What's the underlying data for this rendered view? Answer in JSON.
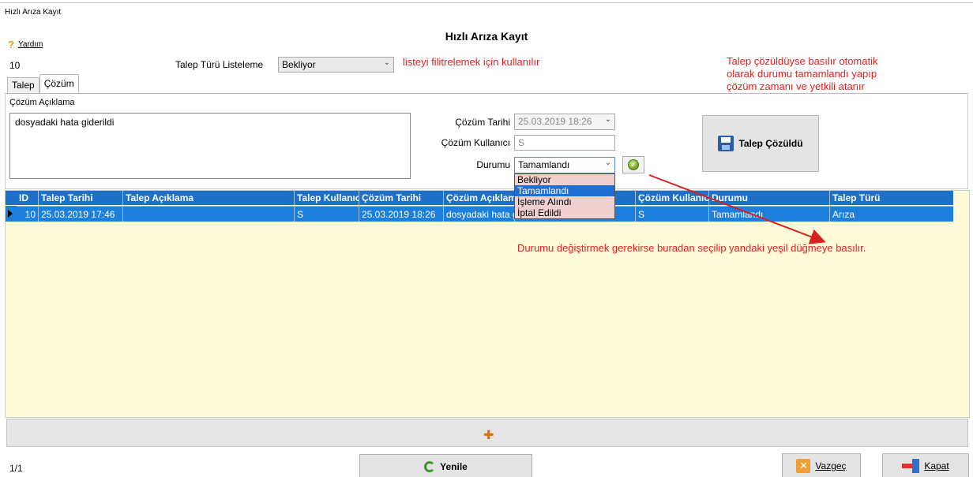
{
  "window": {
    "title": "Hızlı Arıza Kayıt"
  },
  "help": {
    "label": "Yardım"
  },
  "page": {
    "title": "Hızlı Arıza Kayıt"
  },
  "record": {
    "id": "10"
  },
  "filter": {
    "label": "Talep Türü Listeleme",
    "value": "Bekliyor"
  },
  "notes": {
    "filter_note": "listeyi filitrelemek için kullanılır",
    "resolve_note": "Talep çözüldüyse basılır otomatik olarak durumu tamamlandı yapıp çözüm zamanı ve yetkili atanır",
    "status_note": "Durumu değiştirmek gerekirse buradan seçilip yandaki yeşil düğmeye basılır."
  },
  "tabs": [
    {
      "label": "Talep"
    },
    {
      "label": "Çözüm"
    }
  ],
  "solution": {
    "desc_label": "Çözüm Açıklama",
    "desc_value": "dosyadaki hata giderildi",
    "date_label": "Çözüm Tarihi",
    "date_value": "25.03.2019 18:26",
    "user_label": "Çözüm Kullanıcı",
    "user_value": "S",
    "status_label": "Durumu",
    "status_value": "Tamamlandı",
    "status_options": [
      "Bekliyor",
      "Tamamlandı",
      "İşleme Alındı",
      "İptal Edildi"
    ],
    "resolve_button": "Talep Çözüldü"
  },
  "grid": {
    "columns": [
      "ID",
      "Talep Tarihi",
      "Talep Açıklama",
      "Talep Kullanıcı",
      "Çözüm Tarihi",
      "Çözüm Açıklama",
      "",
      "Çözüm Kullanıcı",
      "Durumu",
      "Talep Türü"
    ],
    "rows": [
      [
        "10",
        "25.03.2019 17:46",
        "",
        "S",
        "25.03.2019 18:26",
        "dosyadaki hata giderildi",
        "",
        "S",
        "Tamamlandı",
        "Arıza"
      ]
    ]
  },
  "footer": {
    "pager": "1/1",
    "refresh": "Yenile",
    "cancel": "Vazgeç",
    "close": "Kapat"
  },
  "colors": {
    "accent": "#1b7fdb",
    "note": "#dd2222",
    "grid_bg": "#fffbd9"
  }
}
